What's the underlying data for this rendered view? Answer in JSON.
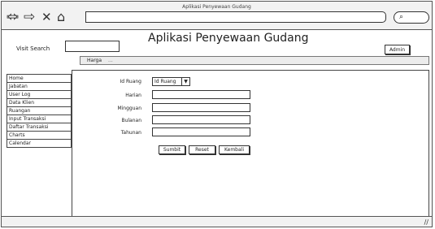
{
  "window": {
    "title": "Aplikasi Penyewaan Gudang"
  },
  "browser": {
    "search_glyph": "⌕"
  },
  "app": {
    "title": "Aplikasi Penyewaan Gudang"
  },
  "header": {
    "visit_search_label": "Visit Search",
    "visit_search_value": "",
    "admin_label": "Admin"
  },
  "breadcrumb": {
    "text": "Harga",
    "suffix": "..."
  },
  "sidebar": {
    "items": [
      {
        "label": "Home"
      },
      {
        "label": "Jabatan"
      },
      {
        "label": "User Log"
      },
      {
        "label": "Data Klien"
      },
      {
        "label": "Ruangan"
      },
      {
        "label": "Input Transaksi"
      },
      {
        "label": "Daftar Transaksi"
      },
      {
        "label": "Charts"
      },
      {
        "label": "Calendar"
      }
    ]
  },
  "form": {
    "id_ruang_label": "Id Ruang",
    "id_ruang_value": "Id Ruang",
    "harian_label": "Harian",
    "mingguan_label": "Mingguan",
    "bulanan_label": "Bulanan",
    "tahunan_label": "Tahunan",
    "submit_label": "Sumbit",
    "reset_label": "Reset",
    "kembali_label": "Kembali"
  }
}
